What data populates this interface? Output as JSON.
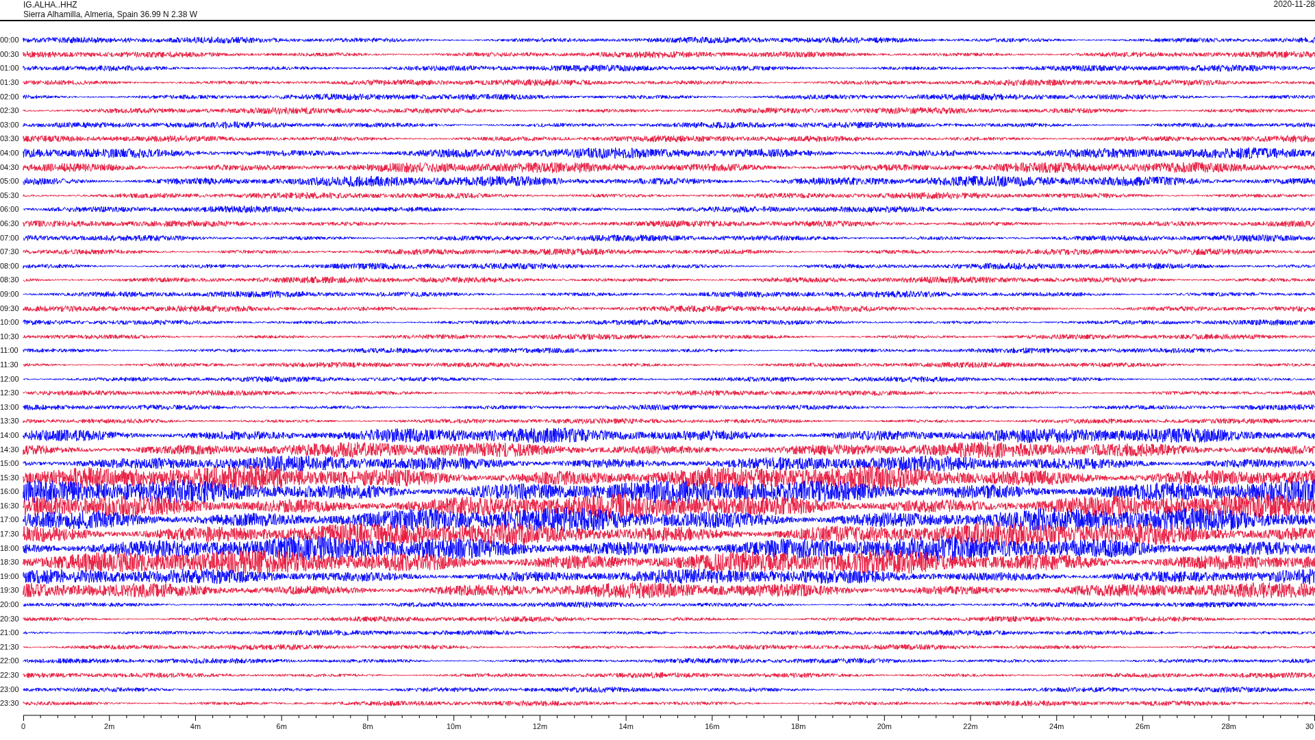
{
  "header": {
    "station": "IG.ALHA..HHZ",
    "location": "Sierra Alhamilla, Almeria, Spain  36.99 N 2.38 W",
    "date": "2020-11-28"
  },
  "traces": [
    {
      "time": "00:00",
      "color": "#0000ff"
    },
    {
      "time": "00:30",
      "color": "#e8173c"
    },
    {
      "time": "01:00",
      "color": "#0000ff"
    },
    {
      "time": "01:30",
      "color": "#e8173c"
    },
    {
      "time": "02:00",
      "color": "#0000ff"
    },
    {
      "time": "02:30",
      "color": "#e8173c"
    },
    {
      "time": "03:00",
      "color": "#0000ff"
    },
    {
      "time": "03:30",
      "color": "#e8173c"
    },
    {
      "time": "04:00",
      "color": "#0000ff"
    },
    {
      "time": "04:30",
      "color": "#e8173c"
    },
    {
      "time": "05:00",
      "color": "#0000ff"
    },
    {
      "time": "05:30",
      "color": "#e8173c"
    },
    {
      "time": "06:00",
      "color": "#0000ff"
    },
    {
      "time": "06:30",
      "color": "#e8173c"
    },
    {
      "time": "07:00",
      "color": "#0000ff"
    },
    {
      "time": "07:30",
      "color": "#e8173c"
    },
    {
      "time": "08:00",
      "color": "#0000ff"
    },
    {
      "time": "08:30",
      "color": "#e8173c"
    },
    {
      "time": "09:00",
      "color": "#0000ff"
    },
    {
      "time": "09:30",
      "color": "#e8173c"
    },
    {
      "time": "10:00",
      "color": "#0000ff"
    },
    {
      "time": "10:30",
      "color": "#e8173c"
    },
    {
      "time": "11:00",
      "color": "#0000ff"
    },
    {
      "time": "11:30",
      "color": "#e8173c"
    },
    {
      "time": "12:00",
      "color": "#0000ff"
    },
    {
      "time": "12:30",
      "color": "#e8173c"
    },
    {
      "time": "13:00",
      "color": "#0000ff"
    },
    {
      "time": "13:30",
      "color": "#e8173c"
    },
    {
      "time": "14:00",
      "color": "#0000ff"
    },
    {
      "time": "14:30",
      "color": "#e8173c"
    },
    {
      "time": "15:00",
      "color": "#0000ff"
    },
    {
      "time": "15:30",
      "color": "#e8173c"
    },
    {
      "time": "16:00",
      "color": "#0000ff"
    },
    {
      "time": "16:30",
      "color": "#e8173c"
    },
    {
      "time": "17:00",
      "color": "#0000ff"
    },
    {
      "time": "17:30",
      "color": "#e8173c"
    },
    {
      "time": "18:00",
      "color": "#0000ff"
    },
    {
      "time": "18:30",
      "color": "#e8173c"
    },
    {
      "time": "19:00",
      "color": "#0000ff"
    },
    {
      "time": "19:30",
      "color": "#e8173c"
    },
    {
      "time": "20:00",
      "color": "#0000ff"
    },
    {
      "time": "20:30",
      "color": "#e8173c"
    },
    {
      "time": "21:00",
      "color": "#0000ff"
    },
    {
      "time": "21:30",
      "color": "#e8173c"
    },
    {
      "time": "22:00",
      "color": "#0000ff"
    },
    {
      "time": "22:30",
      "color": "#e8173c"
    },
    {
      "time": "23:00",
      "color": "#0000ff"
    },
    {
      "time": "23:30",
      "color": "#e8173c"
    }
  ],
  "x_axis": {
    "labels": [
      "0",
      "2m",
      "4m",
      "6m",
      "8m",
      "10m",
      "12m",
      "14m",
      "16m",
      "18m",
      "20m",
      "22m",
      "24m",
      "26m",
      "28m",
      "30"
    ]
  }
}
